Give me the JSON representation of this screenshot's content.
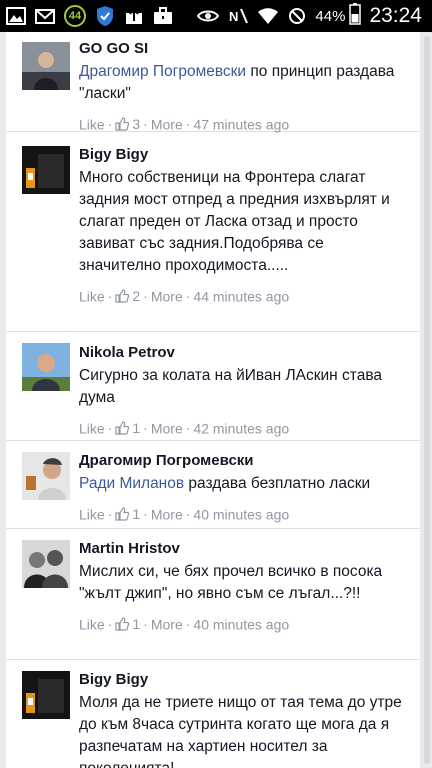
{
  "status_bar": {
    "notification_count": "44",
    "battery_percent": "44%",
    "time": "23:24"
  },
  "comments": [
    {
      "author": "GO GO SI",
      "mention": "Драгомир Погромевски",
      "text": " по принцип раздава \"ласки\"",
      "like_label": "Like",
      "like_count": "3",
      "more_label": "More",
      "time": "47 minutes ago"
    },
    {
      "author": "Bigy Bigy",
      "mention": "",
      "text": "Много собственици на Фронтера слагат задния мост отпред а предния изхвърлят и слагат преден от Ласка отзад и просто завиват със задния.Подобрява се значително проходимоста.....",
      "like_label": "Like",
      "like_count": "2",
      "more_label": "More",
      "time": "44 minutes ago"
    },
    {
      "author": "Nikola Petrov",
      "mention": "",
      "text": "Сигурно за колата на йИван ЛАскин става дума",
      "like_label": "Like",
      "like_count": "1",
      "more_label": "More",
      "time": "42 minutes ago"
    },
    {
      "author": "Драгомир Погромевски",
      "mention": "Ради Миланов",
      "text": " раздава безплатно ласки",
      "like_label": "Like",
      "like_count": "1",
      "more_label": "More",
      "time": "40 minutes ago"
    },
    {
      "author": "Martin Hristov",
      "mention": "",
      "text": "Мислих си, че бях прочел всичко в посока \"жълт джип\", но явно съм се лъгал...?!!",
      "like_label": "Like",
      "like_count": "1",
      "more_label": "More",
      "time": "40 minutes ago"
    },
    {
      "author": "Bigy Bigy",
      "mention": "",
      "text": "Моля да не триете нищо от тая тема до утре до към 8часа сутринта когато ще мога да я разпечатам на хартиен носител за поколенията!",
      "like_label": "",
      "like_count": "",
      "more_label": "",
      "time": ""
    }
  ]
}
